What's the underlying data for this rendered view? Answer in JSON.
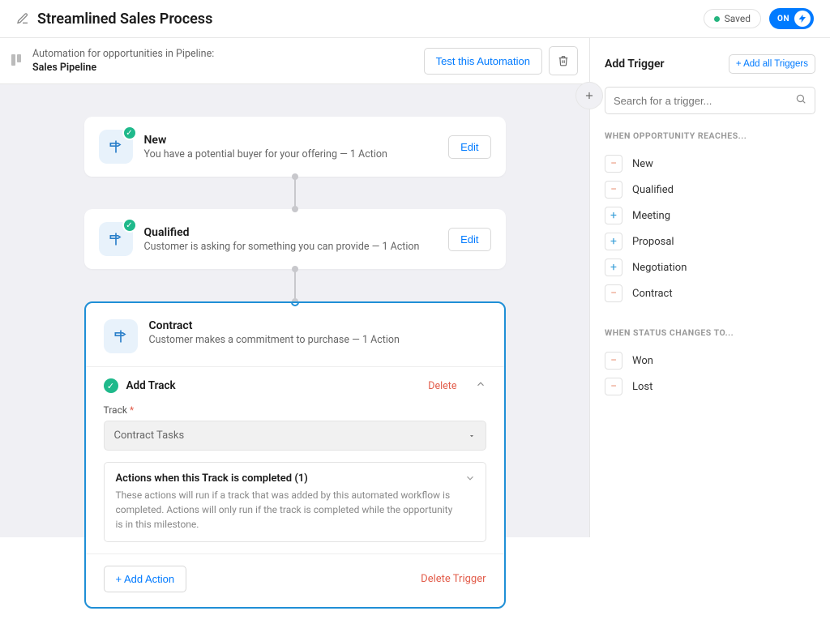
{
  "header": {
    "title": "Streamlined Sales Process",
    "saved_label": "Saved",
    "toggle_label": "ON"
  },
  "subheader": {
    "line1": "Automation for opportunities in Pipeline:",
    "line2": "Sales Pipeline",
    "test_btn": "Test this Automation"
  },
  "cards": [
    {
      "title": "New",
      "sub": "You have a potential buyer for your offering — 1 Action",
      "edit": "Edit"
    },
    {
      "title": "Qualified",
      "sub": "Customer is asking for something you can provide — 1 Action",
      "edit": "Edit"
    }
  ],
  "expanded": {
    "title": "Contract",
    "sub": "Customer makes a commitment to purchase — 1 Action",
    "track_header": "Add Track",
    "delete_label": "Delete",
    "field_label": "Track",
    "field_value": "Contract Tasks",
    "actions_title": "Actions when this Track is completed (1)",
    "actions_desc": "These actions will run if a track that was added by this automated workflow is completed. Actions will only run if the track is completed while the opportunity is in this milestone.",
    "add_action": "+ Add Action",
    "delete_trigger": "Delete Trigger"
  },
  "sidebar": {
    "title": "Add Trigger",
    "add_all": "+ Add all Triggers",
    "search_placeholder": "Search for a trigger...",
    "group1_label": "When Opportunity Reaches...",
    "group1": [
      {
        "sign": "minus",
        "label": "New"
      },
      {
        "sign": "minus",
        "label": "Qualified"
      },
      {
        "sign": "plus",
        "label": "Meeting"
      },
      {
        "sign": "plus",
        "label": "Proposal"
      },
      {
        "sign": "plus",
        "label": "Negotiation"
      },
      {
        "sign": "minus",
        "label": "Contract"
      }
    ],
    "group2_label": "When Status Changes To...",
    "group2": [
      {
        "sign": "minus",
        "label": "Won"
      },
      {
        "sign": "minus",
        "label": "Lost"
      }
    ]
  }
}
